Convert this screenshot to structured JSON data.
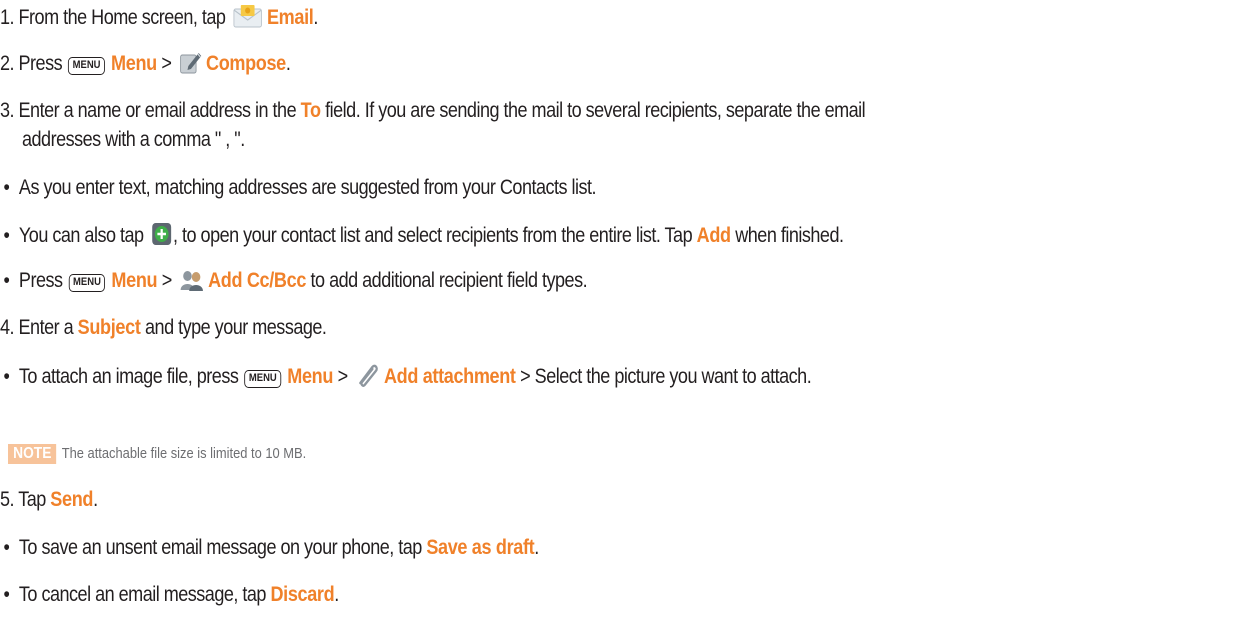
{
  "steps": {
    "s1": {
      "prefix": "1. From the Home screen, tap",
      "email": "Email",
      "suffix": "."
    },
    "s2": {
      "prefix": "2. Press",
      "menu_key": "MENU",
      "menu": "Menu",
      "gt": ">",
      "compose": "Compose",
      "suffix": "."
    },
    "s3": {
      "prefix": "3. Enter a name or email address in the",
      "to": "To",
      "suffix": "field. If you are sending the mail to several recipients, separate the email",
      "line2": "addresses with a comma \" , \"."
    },
    "s3_bullets": {
      "b1": "As you enter text, matching addresses are suggested from your Contacts list.",
      "b2": {
        "prefix": "You can also tap",
        "suffix": ", to open your contact list and select recipients from the entire list. Tap",
        "add": "Add",
        "end": "when finished."
      },
      "b3": {
        "prefix": "Press",
        "menu_key": "MENU",
        "menu": "Menu",
        "gt": ">",
        "addcc": "Add Cc/Bcc",
        "suffix": "to add additional recipient field types."
      }
    },
    "s4": {
      "prefix": "4. Enter a",
      "subject": "Subject",
      "suffix": "and type your message."
    },
    "s4_bullet": {
      "prefix": "To attach an image file, press",
      "menu_key": "MENU",
      "menu": "Menu",
      "gt": ">",
      "attach": "Add attachment",
      "suffix": "> Select the picture you want to attach."
    },
    "note": {
      "badge": "NOTE",
      "text": "The attachable file size is limited to 10 MB."
    },
    "s5": {
      "prefix": "5. Tap",
      "send": "Send",
      "suffix": "."
    },
    "s5_bullets": {
      "b1": {
        "prefix": "To save an unsent email message on your phone, tap",
        "save": "Save as draft",
        "suffix": "."
      },
      "b2": {
        "prefix": "To cancel an email message, tap",
        "discard": "Discard",
        "suffix": "."
      }
    },
    "bullet_char": "•"
  },
  "icons": {
    "email": "email-envelope-icon",
    "compose": "compose-pencil-icon",
    "add_contact": "add-plus-icon",
    "add_cc": "people-icon",
    "attachment": "paperclip-icon"
  },
  "colors": {
    "accent": "#f0812a",
    "text": "#231f20",
    "note_badge": "#f7c39a",
    "note_text": "#6d6e71"
  }
}
